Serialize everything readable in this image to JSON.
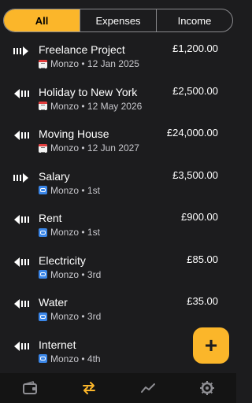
{
  "tabs": [
    {
      "label": "All",
      "active": true
    },
    {
      "label": "Expenses",
      "active": false
    },
    {
      "label": "Income",
      "active": false
    }
  ],
  "transactions": [
    {
      "name": "Freelance Project",
      "account": "Monzo",
      "schedule": "12 Jan 2025",
      "amount": "£1,200.00",
      "direction": "in",
      "schedule_icon": "calendar-icon"
    },
    {
      "name": "Holiday to New York",
      "account": "Monzo",
      "schedule": "12 May 2026",
      "amount": "£2,500.00",
      "direction": "out",
      "schedule_icon": "calendar-icon"
    },
    {
      "name": "Moving House",
      "account": "Monzo",
      "schedule": "12 Jun 2027",
      "amount": "£24,000.00",
      "direction": "out",
      "schedule_icon": "calendar-icon"
    },
    {
      "name": "Salary",
      "account": "Monzo",
      "schedule": "1st",
      "amount": "£3,500.00",
      "direction": "in",
      "schedule_icon": "repeat-icon"
    },
    {
      "name": "Rent",
      "account": "Monzo",
      "schedule": "1st",
      "amount": "£900.00",
      "direction": "out",
      "schedule_icon": "repeat-icon"
    },
    {
      "name": "Electricity",
      "account": "Monzo",
      "schedule": "3rd",
      "amount": "£85.00",
      "direction": "out",
      "schedule_icon": "repeat-icon"
    },
    {
      "name": "Water",
      "account": "Monzo",
      "schedule": "3rd",
      "amount": "£35.00",
      "direction": "out",
      "schedule_icon": "repeat-icon"
    },
    {
      "name": "Internet",
      "account": "Monzo",
      "schedule": "4th",
      "amount": "£",
      "direction": "out",
      "schedule_icon": "repeat-icon"
    }
  ],
  "separator": " • ",
  "fab": {
    "label": "+"
  },
  "nav": [
    {
      "icon": "wallet-icon",
      "active": false
    },
    {
      "icon": "transfer-icon",
      "active": true
    },
    {
      "icon": "trend-icon",
      "active": false
    },
    {
      "icon": "gear-icon",
      "active": false
    }
  ],
  "colors": {
    "accent": "#fbb62a",
    "background": "#1c1c1e",
    "nav_background": "#141414",
    "inactive_icon": "#8e8e93"
  }
}
